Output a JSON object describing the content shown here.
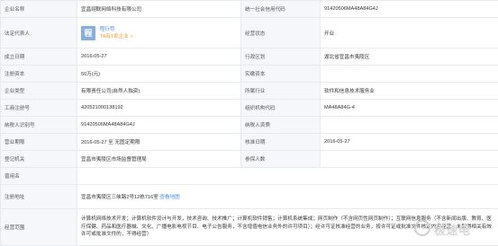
{
  "rows": [
    {
      "l1": "企业名称",
      "v1": "宜昌翊联网络科技有限公司",
      "l2": "统一社会信用代码",
      "v2": "91420506MA48A84G4J"
    },
    {
      "l1": "法定代表人",
      "l2": "经营状态",
      "v2": "开业"
    },
    {
      "l1": "成立日期",
      "v1": "2016-05-27",
      "l2": "行政区划",
      "v2": "湖北省宜昌市夷陵区"
    },
    {
      "l1": "注册资本",
      "v1": "50万(元)",
      "l2": "实缴资本",
      "v2": ""
    },
    {
      "l1": "企业类型",
      "v1": "有限责任公司(自然人独资)",
      "l2": "所属行业",
      "v2": "软件和信息技术服务业"
    },
    {
      "l1": "工商注册号",
      "v1": "420521000138192",
      "l2": "组织机构代码",
      "v2": "MA48A84G-4"
    },
    {
      "l1": "纳税人识别号",
      "v1": "91420506MA48A84G4J",
      "l2": "纳税人资质",
      "v2": ""
    },
    {
      "l1": "营业期限",
      "v1": "2016-05-27 至 无固定期限",
      "l2": "核准日期",
      "v2": "2016-05-27"
    },
    {
      "l1": "登记机关",
      "v1": "宜昌市夷陵区市场监督管理局",
      "l2": "参保人数",
      "v2": ""
    },
    {
      "l1": "曾用名",
      "v1": ""
    }
  ],
  "representative": {
    "avatar_char": "程",
    "name": "程行苟",
    "note": "TA有1家企业 >"
  },
  "address": {
    "label": "注册地址",
    "value": "宜昌市夷陵区三峡路2号12栋716室",
    "link": "查看地图"
  },
  "scope": {
    "label": "经营范围",
    "value": "计算机网络技术开发；计算机软件设计与开发，技术咨询、技术推广；计算机软件销售；计算机系统集成；网页制作（不含网页性网页制作）；互联网信息服务（不含新闻出版、教育、医疗保健、药品和医疗器械、文化、广播电影电视节目、电子公告服务，不含增值电信业务外的许可项目）；经许可证核准经营的业务，按许可证或批准文件核定内容经营，未取得相关有效许可或批准文件的，不得经营）"
  },
  "watermark": {
    "text": "极速电"
  },
  "colors": {
    "label_bg": "#f5f7fa",
    "link": "#4a8de0",
    "accent": "#f29a3a",
    "border": "#e6e9ee"
  }
}
